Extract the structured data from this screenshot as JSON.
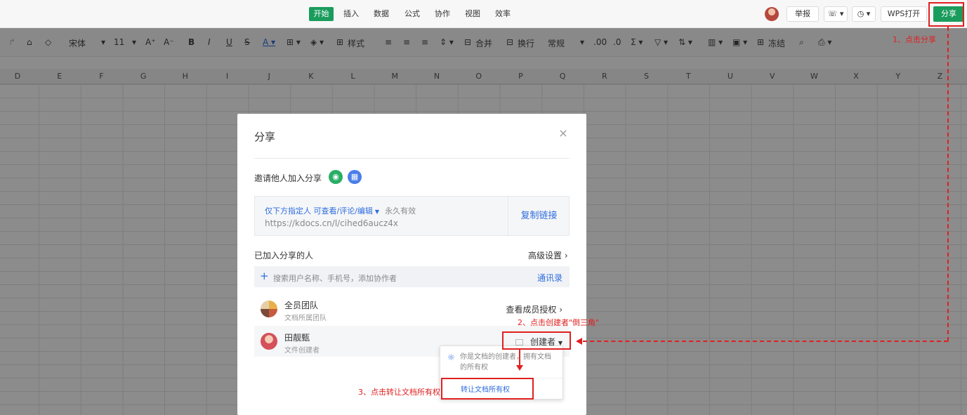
{
  "menubar": {
    "tabs": [
      "开始",
      "插入",
      "数据",
      "公式",
      "协作",
      "视图",
      "效率"
    ],
    "report": "举报",
    "open_wps": "WPS打开",
    "share": "分享"
  },
  "toolbar": {
    "font": "宋体",
    "font_size": "11",
    "style": "样式",
    "merge": "合并",
    "wrap": "换行",
    "number_format": "常规",
    "freeze": "冻结"
  },
  "columns": [
    "D",
    "E",
    "F",
    "G",
    "H",
    "I",
    "J",
    "K",
    "L",
    "M",
    "N",
    "O",
    "P",
    "Q",
    "R",
    "S",
    "T",
    "U",
    "V",
    "W",
    "X",
    "Y",
    "Z"
  ],
  "dialog": {
    "title": "分享",
    "close_icon": "close-icon",
    "invite_label": "邀请他人加入分享",
    "link": {
      "permission": "仅下方指定人 可查看/评论/编辑",
      "validity": "永久有效",
      "url": "https://kdocs.cn/l/cihed6aucz4x",
      "copy_label": "复制链接"
    },
    "members_label": "已加入分享的人",
    "advanced_settings": "高级设置 ›",
    "search": {
      "placeholder": "搜索用户名称、手机号，添加协作者",
      "contacts": "通讯录"
    },
    "members": [
      {
        "name": "全员团队",
        "subtitle": "文档所属团队",
        "action": "查看成员授权 ›"
      },
      {
        "name": "田靓甄",
        "subtitle": "文件创建者",
        "role": "创建者"
      }
    ]
  },
  "popup": {
    "info": "你是文档的创建者，拥有文档的所有权",
    "transfer": "转让文档所有权"
  },
  "annotations": {
    "step1": "1、点击分享",
    "step2": "2、点击创建者\"倒三角\"",
    "step3": "3、点击转让文档所有权",
    "color": "#e02020"
  },
  "colors": {
    "accent_green": "#1a9c5c",
    "link_blue": "#2f6ddd"
  }
}
